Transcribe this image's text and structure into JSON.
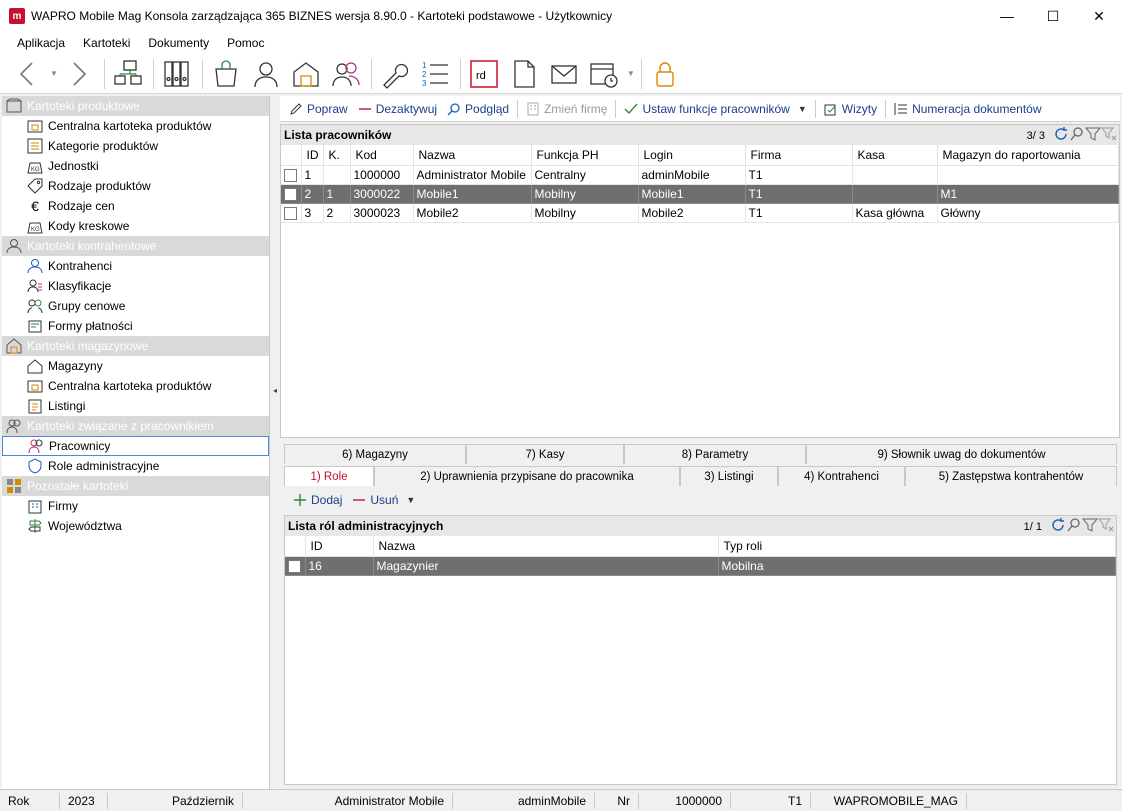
{
  "window": {
    "title": "WAPRO Mobile Mag Konsola zarządzająca 365 BIZNES wersja 8.90.0 - Kartoteki podstawowe - Użytkownicy",
    "logo_letter": "m",
    "minimize": "—",
    "maximize": "☐",
    "close": "✕"
  },
  "menu": [
    "Aplikacja",
    "Kartoteki",
    "Dokumenty",
    "Pomoc"
  ],
  "toolbar": {
    "buttons": [
      "back-arrow-icon",
      "forward-arrow-icon",
      "network-icon",
      "binders-icon",
      "shopping-bag-icon",
      "user-icon",
      "warehouse-icon",
      "users-icon",
      "wrench-icon",
      "numbered-list-icon",
      "report-icon",
      "document-icon",
      "mail-icon",
      "calendar-icon",
      "lock-icon"
    ],
    "report_label": "rd"
  },
  "sidebar": {
    "groups": [
      {
        "title": "Kartoteki produktowe",
        "icon": "box-icon",
        "items": [
          "Centralna kartoteka produktów",
          "Kategorie produktów",
          "Jednostki",
          "Rodzaje produktów",
          "Rodzaje cen",
          "Kody kreskowe"
        ]
      },
      {
        "title": "Kartoteki kontrahentowe",
        "icon": "person-icon",
        "items": [
          "Kontrahenci",
          "Klasyfikacje",
          "Grupy cenowe",
          "Formy płatności"
        ]
      },
      {
        "title": "Kartoteki magazynowe",
        "icon": "warehouse-icon",
        "items": [
          "Magazyny",
          "Centralna kartoteka produktów",
          "Listingi"
        ]
      },
      {
        "title": "Kartoteki związane z pracownikiem",
        "icon": "employee-icon",
        "items": [
          "Pracownicy",
          "Role administracyjne"
        ]
      },
      {
        "title": "Pozostałe kartoteki",
        "icon": "grid-icon",
        "items": [
          "Firmy",
          "Województwa"
        ]
      }
    ],
    "selected": "Pracownicy"
  },
  "actions": {
    "edit": "Popraw",
    "deactivate": "Dezaktywuj",
    "preview": "Podgląd",
    "change_company": "Zmień firmę",
    "set_functions": "Ustaw funkcje pracowników",
    "visits": "Wizyty",
    "doc_numbering": "Numeracja dokumentów"
  },
  "employees": {
    "title": "Lista pracowników",
    "count": "3/ 3",
    "columns": [
      "",
      "ID",
      "K.",
      "Kod",
      "Nazwa",
      "Funkcja PH",
      "Login",
      "Firma",
      "Kasa",
      "Magazyn do raportowania"
    ],
    "rows": [
      [
        "",
        "1",
        "",
        "1000000",
        "Administrator Mobile",
        "Centralny",
        "adminMobile",
        "T1",
        "",
        ""
      ],
      [
        "",
        "2",
        "1",
        "3000022",
        "Mobile1",
        "Mobilny",
        "Mobile1",
        "T1",
        "",
        "M1"
      ],
      [
        "",
        "3",
        "2",
        "3000023",
        "Mobile2",
        "Mobilny",
        "Mobile2",
        "T1",
        "Kasa główna",
        "Główny"
      ]
    ],
    "selected_row": 1
  },
  "tabs": {
    "row1": [
      "6) Magazyny",
      "7) Kasy",
      "8) Parametry",
      "9) Słownik uwag do dokumentów"
    ],
    "row2": [
      "1) Role",
      "2) Uprawnienia przypisane do pracownika",
      "3) Listingi",
      "4) Kontrahenci",
      "5) Zastępstwa kontrahentów"
    ],
    "active": "1) Role"
  },
  "sub_actions": {
    "add": "Dodaj",
    "remove": "Usuń"
  },
  "roles": {
    "title": "Lista ról administracyjnych",
    "count": "1/ 1",
    "columns": [
      "",
      "ID",
      "Nazwa",
      "Typ roli"
    ],
    "rows": [
      [
        "",
        "16",
        "Magazynier",
        "Mobilna"
      ]
    ]
  },
  "status": {
    "year_label": "Rok",
    "year": "2023",
    "month": "Październik",
    "user": "Administrator Mobile",
    "login": "adminMobile",
    "nr_label": "Nr",
    "nr": "1000000",
    "company": "T1",
    "database": "WAPROMOBILE_MAG"
  },
  "colors": {
    "accent_red": "#c8102e",
    "link_blue": "#1a3f8a",
    "selection_gray": "#6f6f6f",
    "group_header": "#d9d9d9"
  }
}
